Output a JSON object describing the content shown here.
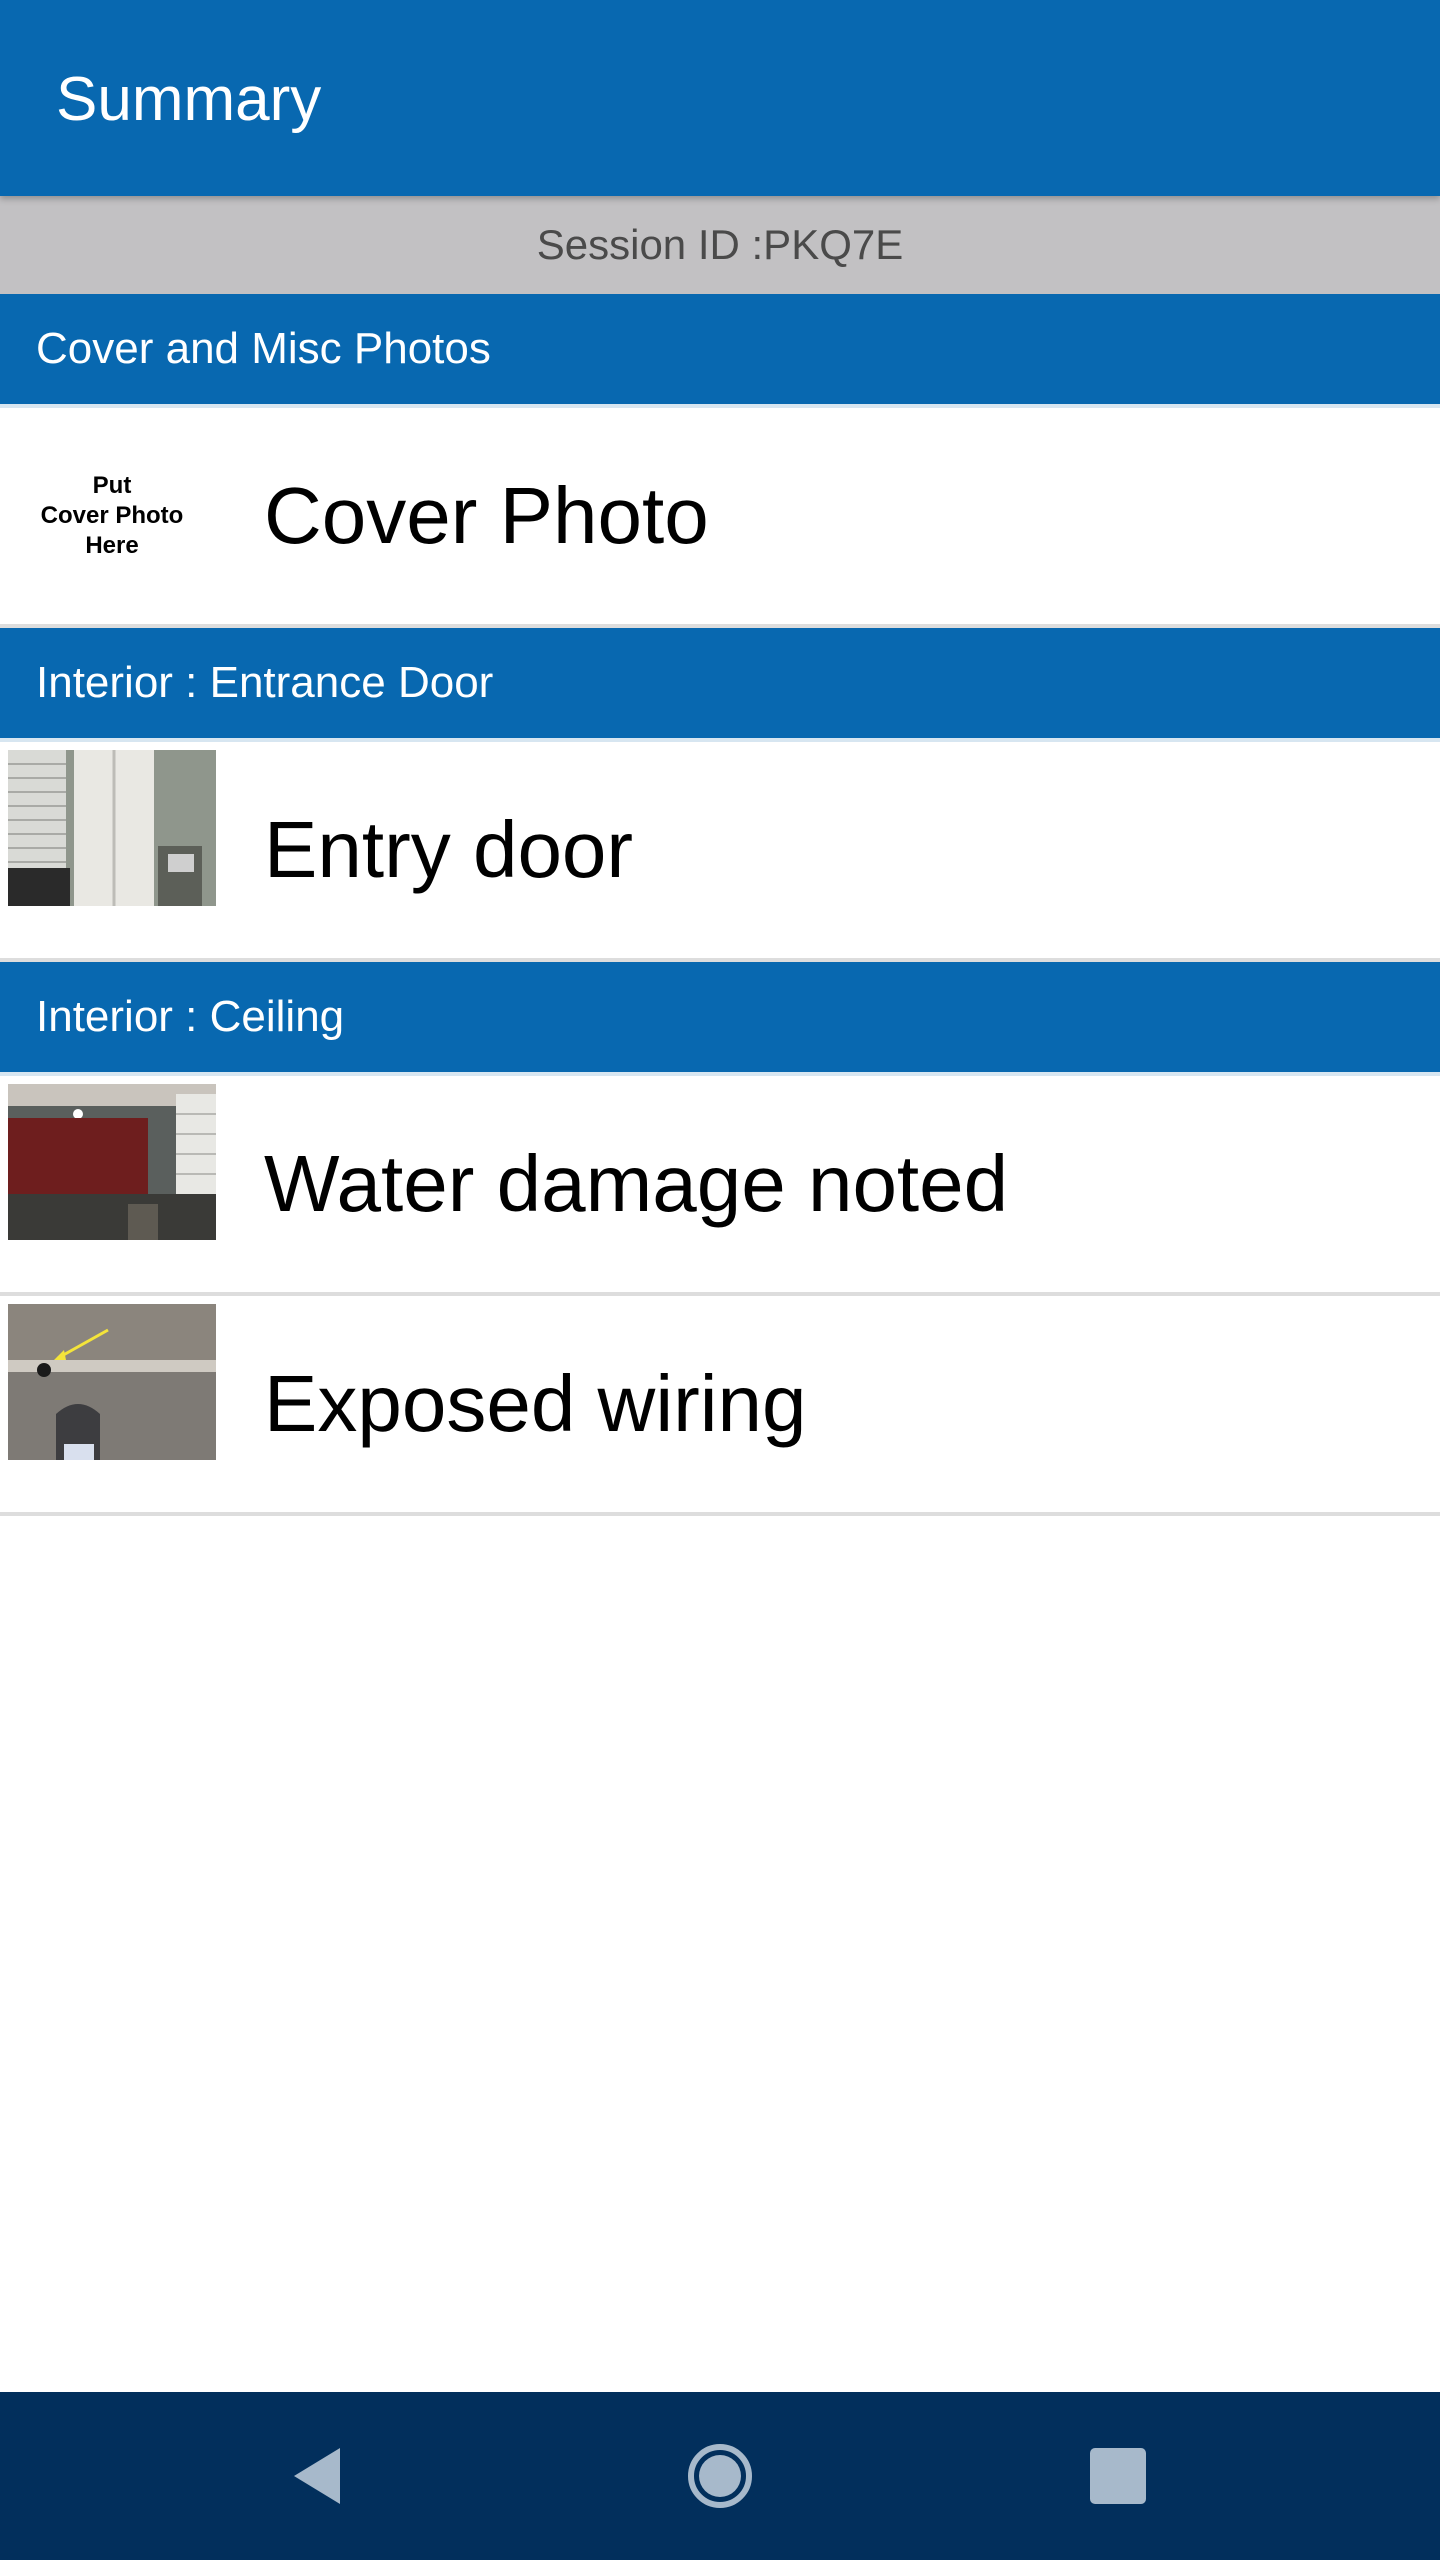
{
  "app_bar": {
    "title": "Summary"
  },
  "session": {
    "text": "Session ID :PKQ7E"
  },
  "sections": [
    {
      "header": "Cover and Misc Photos",
      "items": [
        {
          "label": "Cover Photo",
          "thumbnail": "cover-placeholder",
          "placeholder_lines": [
            "Put",
            "Cover Photo",
            "Here"
          ]
        }
      ]
    },
    {
      "header": "Interior : Entrance Door",
      "items": [
        {
          "label": "Entry door",
          "thumbnail": "entry-door-photo"
        }
      ]
    },
    {
      "header": "Interior : Ceiling",
      "items": [
        {
          "label": "Water damage noted",
          "thumbnail": "room-photo"
        },
        {
          "label": "Exposed wiring",
          "thumbnail": "ceiling-photo"
        }
      ]
    }
  ],
  "nav_bar": {
    "icons": [
      "back-icon",
      "home-icon",
      "recents-icon"
    ]
  },
  "colors": {
    "primary": "#0868b0",
    "session_bar": "#c2c1c3",
    "nav_bar": "#022f5c"
  }
}
